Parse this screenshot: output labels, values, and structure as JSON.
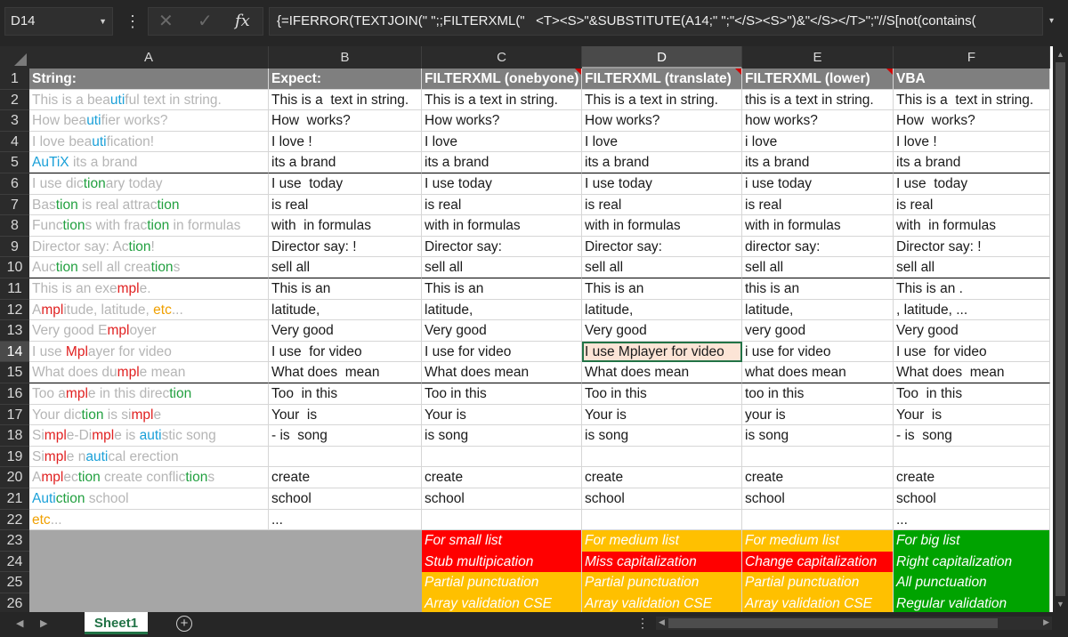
{
  "formula_bar": {
    "name_box": "D14",
    "menu_glyph": "⋮",
    "cancel_glyph": "✕",
    "enter_glyph": "✓",
    "fx_label": "fx",
    "formula": "{=IFERROR(TEXTJOIN(\" \";;FILTERXML(\"   <T><S>\"&SUBSTITUTE(A14;\" \";\"</S><S>\")&\"</S></T>\";\"//S[not(contains(",
    "expand_glyph": "▾"
  },
  "columns": [
    {
      "letter": "A"
    },
    {
      "letter": "B"
    },
    {
      "letter": "C"
    },
    {
      "letter": "D",
      "selected": true
    },
    {
      "letter": "E"
    },
    {
      "letter": "F"
    }
  ],
  "header_row": [
    "String:",
    "Expect:",
    "FILTERXML (onebyone)",
    "FILTERXML (translate)",
    "FILTERXML (lower)",
    "VBA"
  ],
  "rows": [
    {
      "num": "2",
      "a": [
        [
          "This is a bea",
          "g"
        ],
        [
          "uti",
          "b"
        ],
        [
          "ful text in string.",
          "g"
        ]
      ],
      "cells": [
        "This is a  text in string.",
        "This is a text in string.",
        "This is a text in string.",
        "this is a text in string.",
        "This is a  text in string."
      ]
    },
    {
      "num": "3",
      "a": [
        [
          "How bea",
          "g"
        ],
        [
          "uti",
          "b"
        ],
        [
          "fier works?",
          "g"
        ]
      ],
      "cells": [
        "How  works?",
        "How works?",
        "How works?",
        "how works?",
        "How  works?"
      ]
    },
    {
      "num": "4",
      "a": [
        [
          "I love bea",
          "g"
        ],
        [
          "uti",
          "b"
        ],
        [
          "fication!",
          "g"
        ]
      ],
      "cells": [
        "I love !",
        "I love",
        "I love",
        "i love",
        "I love !"
      ]
    },
    {
      "num": "5",
      "a": [
        [
          "AuTiX",
          "b"
        ],
        [
          " its a brand",
          "g"
        ]
      ],
      "cells": [
        "its a brand",
        "its a brand",
        "its a brand",
        "its a brand",
        "its a brand"
      ],
      "thick": true
    },
    {
      "num": "6",
      "a": [
        [
          "I use dic",
          "g"
        ],
        [
          "tion",
          "gr"
        ],
        [
          "ary today",
          "g"
        ]
      ],
      "cells": [
        "I use  today",
        "I use today",
        "I use today",
        "i use today",
        "I use  today"
      ]
    },
    {
      "num": "7",
      "a": [
        [
          "Bas",
          "g"
        ],
        [
          "tion",
          "gr"
        ],
        [
          " is real attrac",
          "g"
        ],
        [
          "tion",
          "gr"
        ]
      ],
      "cells": [
        "is real",
        "is real",
        "is real",
        "is real",
        "is real"
      ]
    },
    {
      "num": "8",
      "a": [
        [
          "Func",
          "g"
        ],
        [
          "tion",
          "gr"
        ],
        [
          "s with frac",
          "g"
        ],
        [
          "tion",
          "gr"
        ],
        [
          " in formulas",
          "g"
        ]
      ],
      "cells": [
        "with  in formulas",
        "with in formulas",
        "with in formulas",
        "with in formulas",
        "with  in formulas"
      ]
    },
    {
      "num": "9",
      "a": [
        [
          "Director say: Ac",
          "g"
        ],
        [
          "tion",
          "gr"
        ],
        [
          "!",
          "g"
        ]
      ],
      "cells": [
        "Director say: !",
        "Director say:",
        "Director say:",
        "director say:",
        "Director say: !"
      ]
    },
    {
      "num": "10",
      "a": [
        [
          "Auc",
          "g"
        ],
        [
          "tion",
          "gr"
        ],
        [
          " sell all crea",
          "g"
        ],
        [
          "tion",
          "gr"
        ],
        [
          "s",
          "g"
        ]
      ],
      "cells": [
        "sell all",
        "sell all",
        "sell all",
        "sell all",
        "sell all"
      ],
      "thick": true
    },
    {
      "num": "11",
      "a": [
        [
          "This is an exe",
          "g"
        ],
        [
          "mpl",
          "r"
        ],
        [
          "e.",
          "g"
        ]
      ],
      "cells": [
        "This is an",
        "This is an",
        "This is an",
        "this is an",
        "This is an ."
      ]
    },
    {
      "num": "12",
      "a": [
        [
          "A",
          "g"
        ],
        [
          "mpl",
          "r"
        ],
        [
          "itude, latitude, ",
          "g"
        ],
        [
          "etc",
          "o"
        ],
        [
          "...",
          "g"
        ]
      ],
      "cells": [
        "latitude,",
        "latitude,",
        "latitude,",
        "latitude,",
        ", latitude, ..."
      ]
    },
    {
      "num": "13",
      "a": [
        [
          "Very good E",
          "g"
        ],
        [
          "mpl",
          "r"
        ],
        [
          "oyer",
          "g"
        ]
      ],
      "cells": [
        "Very good",
        "Very good",
        "Very good",
        "very good",
        "Very good"
      ]
    },
    {
      "num": "14",
      "a": [
        [
          "I use ",
          "g"
        ],
        [
          "Mpl",
          "r"
        ],
        [
          "ayer for video",
          "g"
        ]
      ],
      "cells": [
        "I use  for video",
        "I use for video",
        "I use Mplayer for video",
        "i use for video",
        "I use  for video"
      ],
      "selected": true
    },
    {
      "num": "15",
      "a": [
        [
          "What does du",
          "g"
        ],
        [
          "mpl",
          "r"
        ],
        [
          "e mean",
          "g"
        ]
      ],
      "cells": [
        "What does  mean",
        "What does mean",
        "What does mean",
        "what does mean",
        "What does  mean"
      ],
      "thick": true
    },
    {
      "num": "16",
      "a": [
        [
          "Too a",
          "g"
        ],
        [
          "mpl",
          "r"
        ],
        [
          "e in this direc",
          "g"
        ],
        [
          "tion",
          "gr"
        ]
      ],
      "cells": [
        "Too  in this",
        "Too in this",
        "Too in this",
        "too in this",
        "Too  in this"
      ]
    },
    {
      "num": "17",
      "a": [
        [
          "Your dic",
          "g"
        ],
        [
          "tion",
          "gr"
        ],
        [
          " is si",
          "g"
        ],
        [
          "mpl",
          "r"
        ],
        [
          "e",
          "g"
        ]
      ],
      "cells": [
        "Your  is",
        "Your is",
        "Your is",
        "your is",
        "Your  is"
      ]
    },
    {
      "num": "18",
      "a": [
        [
          "Si",
          "g"
        ],
        [
          "mpl",
          "r"
        ],
        [
          "e-Di",
          "g"
        ],
        [
          "mpl",
          "r"
        ],
        [
          "e is ",
          "g"
        ],
        [
          "auti",
          "b"
        ],
        [
          "stic song",
          "g"
        ]
      ],
      "cells": [
        "- is  song",
        "is song",
        "is song",
        "is song",
        "- is  song"
      ]
    },
    {
      "num": "19",
      "a": [
        [
          "Si",
          "g"
        ],
        [
          "mpl",
          "r"
        ],
        [
          "e n",
          "g"
        ],
        [
          "auti",
          "b"
        ],
        [
          "cal erection",
          "g"
        ]
      ],
      "cells": [
        "",
        "",
        "",
        "",
        ""
      ]
    },
    {
      "num": "20",
      "a": [
        [
          "A",
          "g"
        ],
        [
          "mpl",
          "r"
        ],
        [
          "ec",
          "g"
        ],
        [
          "tion",
          "gr"
        ],
        [
          " create conflic",
          "g"
        ],
        [
          "tion",
          "gr"
        ],
        [
          "s",
          "g"
        ]
      ],
      "cells": [
        "create",
        "create",
        "create",
        "create",
        "create"
      ]
    },
    {
      "num": "21",
      "a": [
        [
          "Auti",
          "b"
        ],
        [
          "ction",
          "gr"
        ],
        [
          " school",
          "g"
        ]
      ],
      "cells": [
        "school",
        "school",
        "school",
        "school",
        "school"
      ]
    },
    {
      "num": "22",
      "a": [
        [
          "etc",
          "o"
        ],
        [
          "...",
          "g"
        ]
      ],
      "cells": [
        "...",
        "",
        "",
        "",
        "..."
      ]
    }
  ],
  "note_rows": [
    {
      "num": "23",
      "notes": [
        {
          "text": "For small list",
          "color": "red"
        },
        {
          "text": "For medium list",
          "color": "orange"
        },
        {
          "text": "For medium list",
          "color": "orange"
        },
        {
          "text": "For big list",
          "color": "green"
        }
      ]
    },
    {
      "num": "24",
      "notes": [
        {
          "text": "Stub multipication",
          "color": "red"
        },
        {
          "text": "Miss capitalization",
          "color": "red"
        },
        {
          "text": "Change capitalization",
          "color": "red"
        },
        {
          "text": "Right capitalization",
          "color": "green"
        }
      ]
    },
    {
      "num": "25",
      "notes": [
        {
          "text": "Partial punctuation",
          "color": "orange"
        },
        {
          "text": "Partial punctuation",
          "color": "orange"
        },
        {
          "text": "Partial punctuation",
          "color": "orange"
        },
        {
          "text": "All punctuation",
          "color": "green"
        }
      ]
    },
    {
      "num": "26",
      "notes": [
        {
          "text": "Array validation CSE",
          "color": "orange"
        },
        {
          "text": "Array validation CSE",
          "color": "orange"
        },
        {
          "text": "Array validation CSE",
          "color": "orange"
        },
        {
          "text": "Regular validation",
          "color": "green"
        }
      ]
    }
  ],
  "bottom_bar": {
    "prev_glyph": "◀",
    "next_glyph": "▶",
    "sheet_tab": "Sheet1",
    "add_sheet_glyph": "+",
    "tabs_menu_glyph": "⋮"
  },
  "colors": {
    "accent": "#217346",
    "header_fill": "#7f7f7f",
    "note_red": "#ff0000",
    "note_orange": "#ffc000",
    "note_green": "#00a300",
    "active_cell_fill": "#fce4d6"
  }
}
